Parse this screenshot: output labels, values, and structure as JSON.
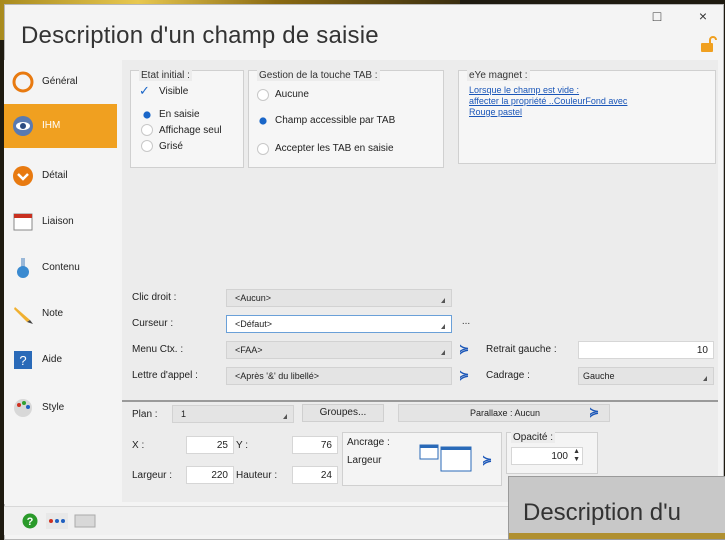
{
  "window": {
    "title": "Description d'un champ de saisie",
    "minimize_glyph": "□",
    "close_glyph": "×"
  },
  "sidebar": {
    "items": [
      {
        "label": "Général",
        "icon": "general-icon"
      },
      {
        "label": "IHM",
        "icon": "eye-icon",
        "selected": true
      },
      {
        "label": "Détail",
        "icon": "detail-icon"
      },
      {
        "label": "Liaison",
        "icon": "link-icon"
      },
      {
        "label": "Contenu",
        "icon": "flask-icon"
      },
      {
        "label": "Note",
        "icon": "pencil-icon"
      },
      {
        "label": "Aide",
        "icon": "help-book-icon"
      },
      {
        "label": "Style",
        "icon": "palette-icon"
      }
    ]
  },
  "etat_initial": {
    "title": "Etat initial :",
    "visible_label": "Visible",
    "options": [
      "En saisie",
      "Affichage seul",
      "Grisé"
    ],
    "selected": "En saisie"
  },
  "gestion_tab": {
    "title": "Gestion de la touche TAB :",
    "options": [
      "Aucune",
      "Champ accessible par TAB",
      "Accepter les TAB en saisie"
    ],
    "selected": "Champ accessible par TAB"
  },
  "eye_magnet": {
    "title": "eYe magnet :",
    "line1": "Lorsque le champ est vide :",
    "line2": "affecter la propriété ..CouleurFond avec",
    "line3": "Rouge pastel"
  },
  "form": {
    "clic_droit": {
      "label": "Clic droit :",
      "value": "<Aucun>"
    },
    "curseur": {
      "label": "Curseur :",
      "value": "<Défaut>",
      "dots": "..."
    },
    "menu_ctx": {
      "label": "Menu Ctx. :",
      "value": "<FAA>"
    },
    "lettre_appel": {
      "label": "Lettre d'appel :",
      "value": "<Après '&' du libellé>"
    },
    "retrait_gauche": {
      "label": "Retrait gauche :",
      "value": "10"
    },
    "cadrage": {
      "label": "Cadrage :",
      "value": "Gauche"
    }
  },
  "bottom": {
    "plan_label": "Plan :",
    "plan_value": "1",
    "groupes_label": "Groupes...",
    "parallaxe_label": "Parallaxe : Aucun",
    "x_label": "X :",
    "x_value": "25",
    "y_label": "Y :",
    "y_value": "76",
    "largeur_label": "Largeur :",
    "largeur_value": "220",
    "hauteur_label": "Hauteur :",
    "hauteur_value": "24",
    "ancrage_label": "Ancrage :",
    "ancrage_value": "Largeur",
    "opacite_label": "Opacité :",
    "opacite_value": "100"
  },
  "overlay": {
    "title": "Description d'u"
  },
  "colors": {
    "accent": "#f0a020",
    "link": "#1a56b8",
    "radio_on": "#1a66c8"
  }
}
